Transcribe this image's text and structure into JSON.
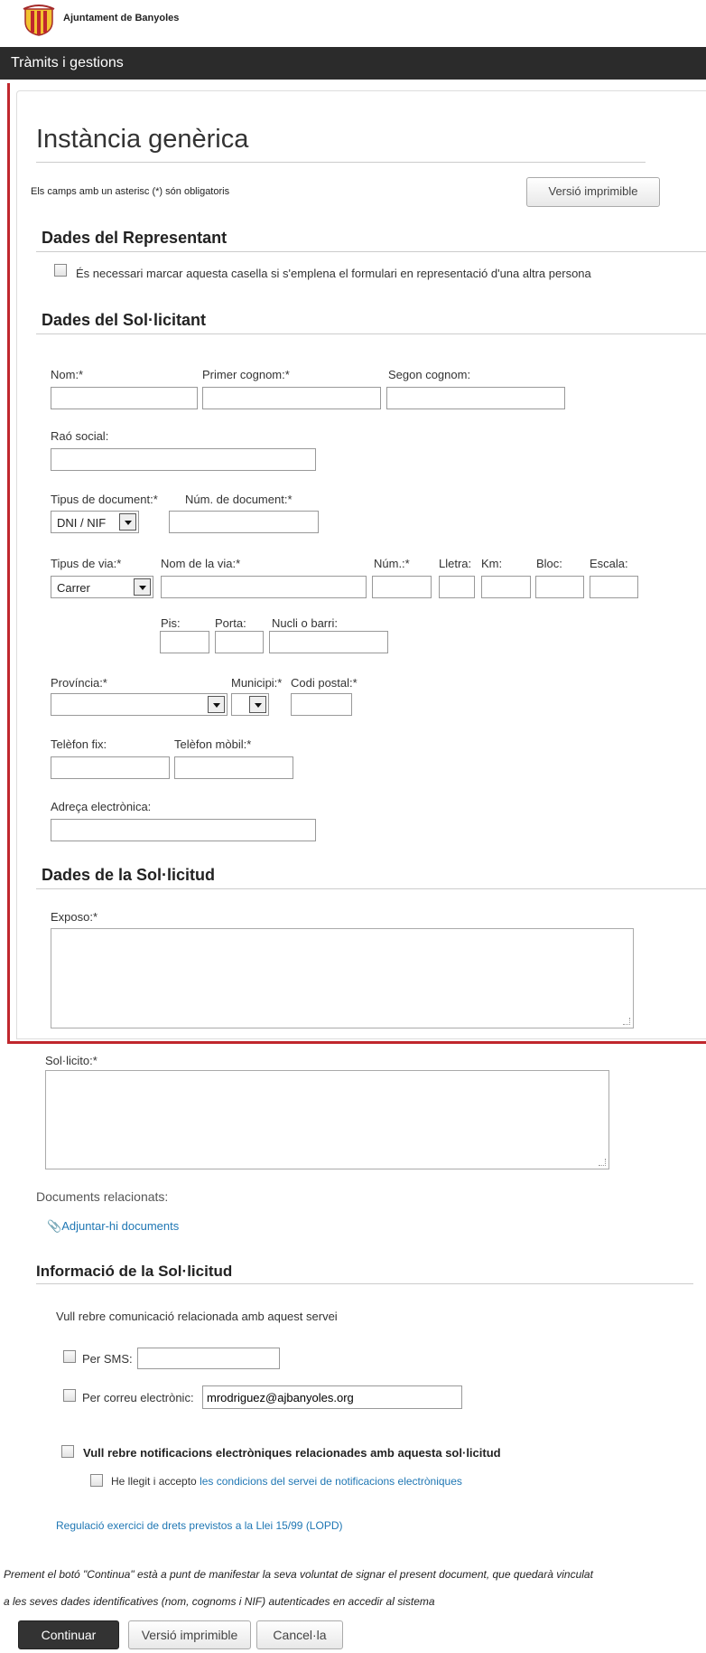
{
  "header": {
    "org_name": "Ajuntament de Banyoles",
    "section_title": "Tràmits i gestions"
  },
  "page": {
    "title": "Instància genèrica",
    "required_note": "Els camps amb un asterisc (*) són obligatoris",
    "print_button": "Versió imprimible"
  },
  "representant": {
    "heading": "Dades del Representant",
    "checkbox_label": "És necessari marcar aquesta casella si s'emplena el formulari en representació d'una altra persona"
  },
  "solicitant": {
    "heading": "Dades del Sol·licitant",
    "nom_label": "Nom:*",
    "cognom1_label": "Primer cognom:*",
    "cognom2_label": "Segon cognom:",
    "rao_label": "Raó social:",
    "tipus_doc_label": "Tipus de document:*",
    "tipus_doc_value": "DNI / NIF",
    "num_doc_label": "Núm. de document:*",
    "tipus_via_label": "Tipus de via:*",
    "tipus_via_value": "Carrer",
    "nom_via_label": "Nom de la via:*",
    "num_label": "Núm.:*",
    "lletra_label": "Lletra:",
    "km_label": "Km:",
    "bloc_label": "Bloc:",
    "escala_label": "Escala:",
    "pis_label": "Pis:",
    "porta_label": "Porta:",
    "nucli_label": "Nucli o barri:",
    "provincia_label": "Província:*",
    "municipi_label": "Municipi:*",
    "cp_label": "Codi postal:*",
    "tel_fix_label": "Telèfon fix:",
    "tel_mobil_label": "Telèfon mòbil:*",
    "email_label": "Adreça electrònica:"
  },
  "solicitud": {
    "heading": "Dades de la Sol·licitud",
    "exposo_label": "Exposo:*",
    "solicito_label": "Sol·licito:*",
    "docs_label": "Documents relacionats:",
    "attach_link": "Adjuntar-hi documents"
  },
  "informacio": {
    "heading": "Informació de la Sol·licitud",
    "intro": "Vull rebre comunicació relacionada amb aquest servei",
    "sms_label": "Per SMS:",
    "email_label": "Per correu electrònic:",
    "email_value": "mrodriguez@ajbanyoles.org",
    "notif_label": "Vull rebre notificacions electròniques relacionades amb aquesta sol·licitud",
    "accept_prefix": "He llegit i accepto",
    "accept_link": "les condicions del servei de notificacions electròniques",
    "lopd_link": "Regulació exercici de drets previstos a la Llei 15/99 (LOPD)"
  },
  "footer": {
    "legal_line1": "Prement el botó \"Continua\" està a punt de manifestar la seva voluntat de signar el present document, que quedarà vinculat",
    "legal_line2": "a les seves dades identificatives (nom, cognoms i NIF) autenticades en accedir al sistema",
    "continue_button": "Continuar",
    "print_button": "Versió imprimible",
    "cancel_button": "Cancel·la"
  },
  "colors": {
    "header_bar": "#2b2b2b",
    "highlight_border": "#c0272d",
    "link": "#1f77b4",
    "primary_button": "#333333"
  }
}
